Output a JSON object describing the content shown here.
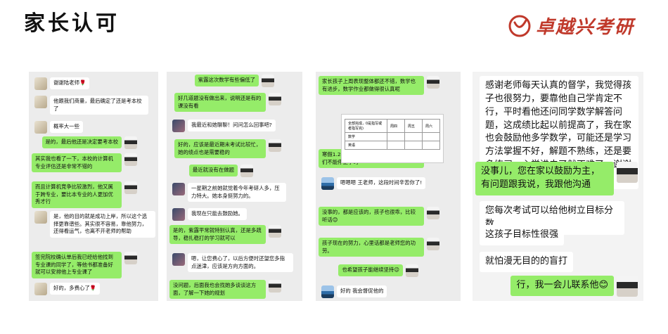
{
  "header": {
    "title": "家长认可",
    "brand": "卓越兴考研",
    "brand_color": "#c0392b"
  },
  "panels": [
    {
      "messages": [
        {
          "side": "left",
          "avatar": "cat",
          "text": "谢谢陆老师🌹"
        },
        {
          "side": "left",
          "avatar": "cat",
          "text": "他跟我们商量，最后确定了还是考本校了"
        },
        {
          "side": "left",
          "avatar": "cat",
          "text": "概率大一些"
        },
        {
          "side": "right",
          "avatar": "girl",
          "text": "是的，最后他还是决定要考本校"
        },
        {
          "side": "right",
          "avatar": "girl",
          "text": "其实我也看了一下，本校的计算机专业评估还是非常不错的"
        },
        {
          "side": "right",
          "avatar": "girl",
          "text": "而且计算机竞争比较激烈，他又属于跨专业，要比本专业的人更加优秀才行"
        },
        {
          "side": "left",
          "avatar": "cat",
          "text": "是，他的目的就是成功上岸，所以这个选择更靠谱些。其实很不容易，靠他努力，还得看运气，也离不开老师的帮助"
        },
        {
          "side": "right",
          "avatar": "girl",
          "text": "签完院校确认单后我已经给他找到专业课的同学了，等他书都准备好就可以安排他上专业课了"
        },
        {
          "side": "left",
          "avatar": "cat",
          "text": "好的，多费心了🌹"
        }
      ]
    },
    {
      "messages": [
        {
          "side": "right",
          "avatar": "girl",
          "text": "紫露这次数学有些偏低了"
        },
        {
          "side": "right",
          "avatar": "girl",
          "text": "好几道题没有做出来，说明还是有的课没有看"
        },
        {
          "side": "left",
          "avatar": "dark",
          "text": "我最近和她聊聊！问问怎么回事吧?"
        },
        {
          "side": "right",
          "avatar": "girl",
          "text": "好的，应该是最近期末考试比较忙，她的绩点也是需要稳的"
        },
        {
          "side": "right",
          "avatar": "girl",
          "text": "最近就没有在做题"
        },
        {
          "side": "left",
          "avatar": "dark",
          "text": "一星期之前她就觉着今年考研人多，压力特大。她本身挺努力的。"
        },
        {
          "side": "left",
          "avatar": "dark",
          "text": "我现在只能去鼓励她。"
        },
        {
          "side": "right",
          "avatar": "girl",
          "text": "是的，紫露平常就特别认真，还是多疏导，稳扎稳打的学习就可以"
        },
        {
          "side": "left",
          "avatar": "dark",
          "text": "嗯，让您费心了，以后方便时还望您多指点迷津，应该是方向方面的。"
        },
        {
          "side": "right",
          "avatar": "girl",
          "text": "没问题，后面我也会找她多谈谈这方面，了解一下她的规划"
        }
      ]
    },
    {
      "messages": [
        {
          "side": "right",
          "avatar": "girl",
          "text": "家长孩子上周表现整体都还不错，数学也有进步，数学作业都做得很认真呢"
        },
        {
          "side": "right",
          "avatar": "girl",
          "text": "寒假1.24-2.6没布置新作业了，也让孩子们不能停止学习"
        },
        {
          "side": "left",
          "avatar": "lake",
          "text": "嗯嗯嗯 王老师，这段时间辛苦你了!"
        },
        {
          "side": "right",
          "avatar": "girl",
          "text": "没事的，都是应该的，孩子也很乖，比较听话😊"
        },
        {
          "side": "right",
          "avatar": "girl",
          "text": "孩子现在的努力，心里话都是老师您的功劳。"
        },
        {
          "side": "right",
          "avatar": "girl",
          "text": "也希望孩子能继续坚持😉"
        },
        {
          "side": "left",
          "avatar": "lake",
          "text": "好的 我会督促他的"
        }
      ],
      "table": {
        "headers": [
          "全部完成，0是指写或者指写完)",
          "周四",
          "周五",
          "周六"
        ],
        "rows": [
          [
            "数学",
            "",
            "",
            ""
          ],
          [
            "英语",
            "",
            "",
            ""
          ]
        ]
      }
    },
    {
      "messages": [
        {
          "side": "left",
          "avatar": "none",
          "text": "感谢老师每天认真的督学，我觉得孩子也很努力，要靠他自己学肯定不行，平时看他还问同学数学解答问题，这成绩比起以前提高了，我在家也会鼓励他多学数学，可能还是学习方法掌握不好，解题不熟练，还是要多练习，心学进去了就不难了，谢谢明阳老师☕"
        },
        {
          "side": "right",
          "avatar": "girl",
          "text": "没事儿，您在家以鼓励为主，有问题跟我说，我跟他沟通"
        },
        {
          "side": "left",
          "avatar": "none",
          "text": "您每次考试可以给他树立目标分数"
        },
        {
          "side": "left",
          "avatar": "none",
          "text": "这孩子目标性很强"
        },
        {
          "side": "left",
          "avatar": "none",
          "text": "就怕漫无目的的盲打"
        },
        {
          "side": "right",
          "avatar": "girl",
          "text": "行，我一会儿联系他😊"
        }
      ]
    }
  ]
}
